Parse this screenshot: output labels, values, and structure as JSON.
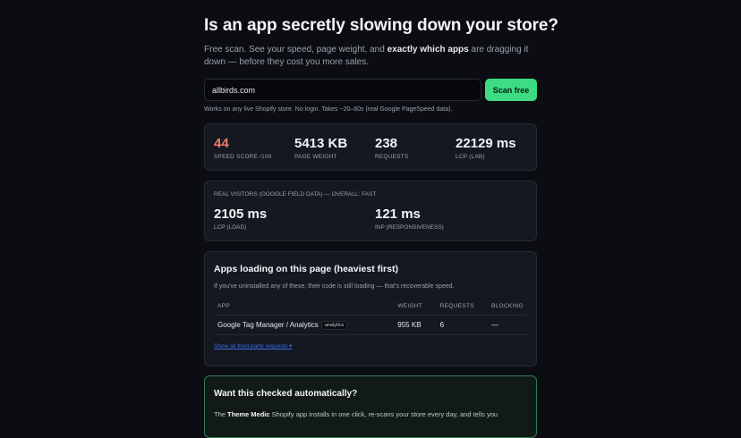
{
  "hero": {
    "title": "Is an app secretly slowing down your store?",
    "lede_part1": "Free scan. See your speed, page weight, and ",
    "lede_bold": "exactly which apps",
    "lede_part2": " are dragging it down — before they cost you more sales."
  },
  "search": {
    "value": "allbirds.com",
    "button_label": "Scan free",
    "hint": "Works on any live Shopify store. No login. Takes ~20–60s (real Google PageSpeed data)."
  },
  "metrics": [
    {
      "value": "44",
      "label": "SPEED SCORE /100",
      "status": "poor"
    },
    {
      "value": "5413 KB",
      "label": "PAGE WEIGHT"
    },
    {
      "value": "238",
      "label": "REQUESTS"
    },
    {
      "value": "22129 ms",
      "label": "LCP (LAB)"
    }
  ],
  "field_data": {
    "heading": "REAL VISITORS (GOOGLE FIELD DATA) — OVERALL: FAST",
    "metrics": [
      {
        "value": "2105 ms",
        "label": "LCP (LOAD)"
      },
      {
        "value": "121 ms",
        "label": "INP (RESPONSIVENESS)"
      }
    ]
  },
  "apps": {
    "title": "Apps loading on this page (heaviest first)",
    "subtitle": "If you've uninstalled any of these, their code is still loading — that's recoverable speed.",
    "columns": [
      "APP",
      "WEIGHT",
      "REQUESTS",
      "BLOCKING"
    ],
    "rows": [
      {
        "name": "Google Tag Manager / Analytics",
        "tag": "analytics",
        "weight": "955 KB",
        "requests": "6",
        "blocking": "—"
      }
    ],
    "raw_link": "Show all third-party requests ▾"
  },
  "cta": {
    "title": "Want this checked automatically?",
    "body_part1": "The ",
    "body_bold": "Theme Medic",
    "body_part2": " Shopify app installs in one click, re-scans your store every day, and tells you"
  },
  "colors": {
    "background": "#0b0d12",
    "card": "#151821",
    "accent": "#3ddc84",
    "poor": "#f07a6a",
    "link": "#3b6ee0"
  }
}
